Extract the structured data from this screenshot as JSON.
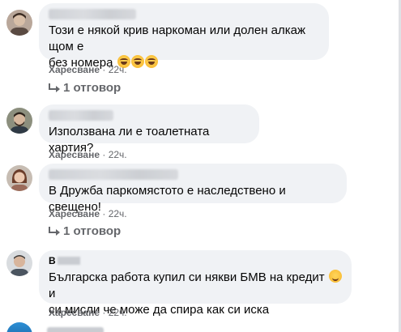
{
  "comments": [
    {
      "text_line1": "Този е някой крив наркоман или долен алкаж щом е",
      "text_line2": "без номера",
      "like_label": "Харесване",
      "time": "22ч.",
      "reply_label": "1 отговор"
    },
    {
      "text": "Използвана ли е тоалетната хартия?",
      "like_label": "Харесване",
      "time": "22ч."
    },
    {
      "text": "В Дружба паркомястото е наследствено и свещено!",
      "like_label": "Харесване",
      "time": "22ч.",
      "reply_label": "1 отговор"
    },
    {
      "author_partial": "В",
      "text_line1": "Българска работа купил си някви БМВ на кредит",
      "text_line1_tail": "и",
      "text_line2": "си мисли че може да спира как си иска",
      "like_label": "Харесване",
      "time": "22ч."
    }
  ],
  "emoji_icons": [
    "laughing-crying-emoji",
    "winking-emoji"
  ],
  "colors": {
    "bubble": "#f0f2f5",
    "meta_text": "#65676b",
    "body_text": "#050505"
  }
}
